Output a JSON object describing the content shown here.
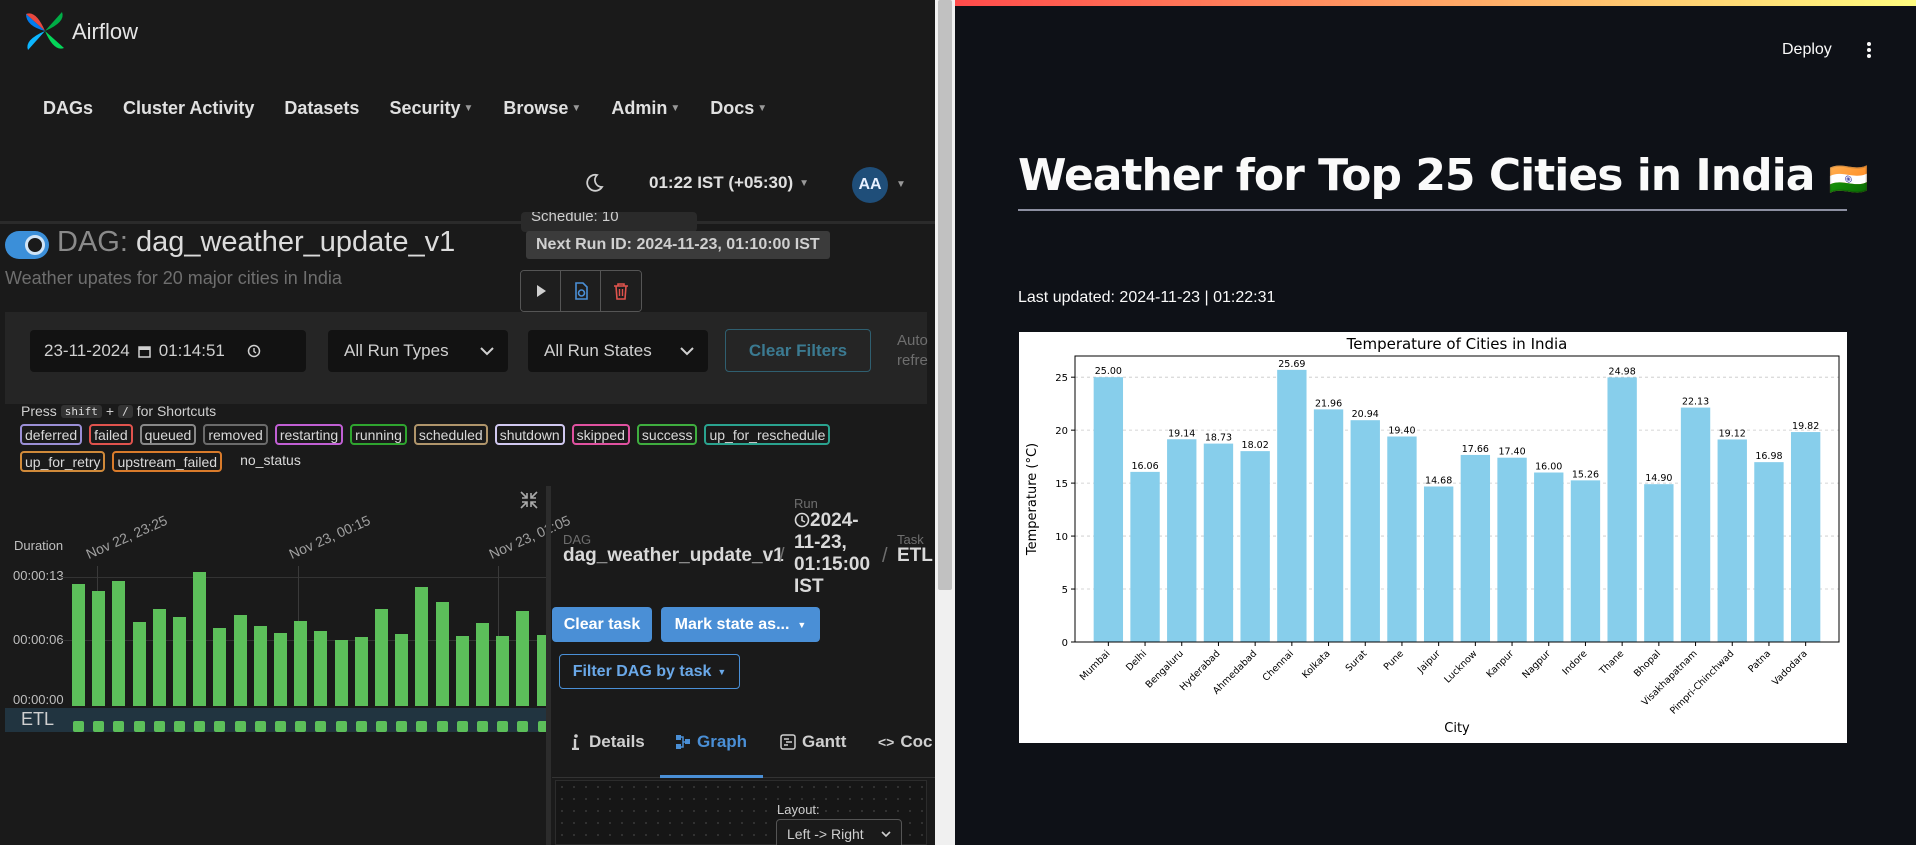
{
  "airflow": {
    "brand": "Airflow",
    "nav": [
      {
        "label": "DAGs",
        "dropdown": false
      },
      {
        "label": "Cluster Activity",
        "dropdown": false
      },
      {
        "label": "Datasets",
        "dropdown": false
      },
      {
        "label": "Security",
        "dropdown": true
      },
      {
        "label": "Browse",
        "dropdown": true
      },
      {
        "label": "Admin",
        "dropdown": true
      },
      {
        "label": "Docs",
        "dropdown": true
      }
    ],
    "timezone": "01:22 IST (+05:30)",
    "avatar": "AA",
    "dag_prefix": "DAG:",
    "dag_id": "dag_weather_update_v1",
    "description": "Weather upates for 20 major cities in India",
    "schedule": "Schedule: 10",
    "next_run": "Next Run ID: 2024-11-23, 01:10:00 IST",
    "filters": {
      "date": "23-11-2024",
      "time": "01:14:51",
      "run_types": "All Run Types",
      "run_states": "All Run States",
      "clear": "Clear Filters",
      "auto_refresh_1": "Auto",
      "auto_refresh_2": "refre"
    },
    "shortcuts": {
      "press": "Press",
      "key1": "shift",
      "plus": "+",
      "key2": "/",
      "suffix": "for Shortcuts"
    },
    "states": [
      {
        "label": "deferred",
        "color": "#9b8fd6"
      },
      {
        "label": "failed",
        "color": "#e0534d"
      },
      {
        "label": "queued",
        "color": "#888888"
      },
      {
        "label": "removed",
        "color": "#6b6b6b"
      },
      {
        "label": "restarting",
        "color": "#c15fd4"
      },
      {
        "label": "running",
        "color": "#2fa52f"
      },
      {
        "label": "scheduled",
        "color": "#b0956b"
      },
      {
        "label": "shutdown",
        "color": "#d0c8f0"
      },
      {
        "label": "skipped",
        "color": "#e052a0"
      },
      {
        "label": "success",
        "color": "#3fae3f"
      },
      {
        "label": "up_for_reschedule",
        "color": "#2aa38f"
      },
      {
        "label": "up_for_retry",
        "color": "#d08a3a"
      },
      {
        "label": "upstream_failed",
        "color": "#d97b2b"
      },
      {
        "label": "no_status",
        "color": ""
      }
    ],
    "grid": {
      "duration_label": "Duration",
      "y_ticks": [
        "00:00:13",
        "00:00:06",
        "00:00:00"
      ],
      "date_labels": [
        "Nov 22, 23:25",
        "Nov 23, 00:15",
        "Nov 23, 01:05"
      ],
      "durations_sec": [
        12.3,
        11.6,
        12.6,
        8.5,
        9.8,
        9.0,
        13.5,
        7.9,
        9.2,
        8.1,
        7.4,
        8.6,
        7.6,
        6.7,
        7.0,
        9.8,
        7.3,
        12.0,
        10.5,
        7.1,
        8.4,
        7.1,
        9.6,
        7.2
      ],
      "task_row": "ETL"
    },
    "details": {
      "dag_label": "DAG",
      "dag": "dag_weather_update_v1",
      "run_label": "Run",
      "run": "2024-11-23, 01:15:00 IST",
      "task_label": "Task",
      "task": "ETL",
      "clear_task": "Clear task",
      "mark_state": "Mark state as...",
      "filter_dag": "Filter DAG by task",
      "tabs": [
        {
          "label": "Details",
          "icon": "info-icon"
        },
        {
          "label": "Graph",
          "icon": "graph-icon"
        },
        {
          "label": "Gantt",
          "icon": "gantt-icon"
        },
        {
          "label": "Coc",
          "icon": "code-icon"
        }
      ],
      "layout_label": "Layout:",
      "layout_value": "Left -> Right"
    }
  },
  "streamlit": {
    "deploy": "Deploy",
    "title": "Weather for Top 25 Cities in India",
    "flag": "🇮🇳",
    "updated": "Last updated: 2024-11-23 | 01:22:31"
  },
  "chart_data": {
    "type": "bar",
    "title": "Temperature of Cities in India",
    "xlabel": "City",
    "ylabel": "Temperature (°C)",
    "ylim": [
      0,
      27
    ],
    "yticks": [
      0,
      5,
      10,
      15,
      20,
      25
    ],
    "grid": "y-dashed",
    "bar_color": "#87ceeb",
    "categories": [
      "Mumbai",
      "Delhi",
      "Bengaluru",
      "Hyderabad",
      "Ahmedabad",
      "Chennai",
      "Kolkata",
      "Surat",
      "Pune",
      "Jaipur",
      "Lucknow",
      "Kanpur",
      "Nagpur",
      "Indore",
      "Thane",
      "Bhopal",
      "Visakhapatnam",
      "Pimpri-Chinchwad",
      "Patna",
      "Vadodara"
    ],
    "values": [
      25.0,
      16.06,
      19.14,
      18.73,
      18.02,
      25.69,
      21.96,
      20.94,
      19.4,
      14.68,
      17.66,
      17.4,
      16.0,
      15.26,
      24.98,
      14.9,
      22.13,
      19.12,
      16.98,
      19.82
    ],
    "data_labels": [
      "25.00",
      "16.06",
      "19.14",
      "18.73",
      "18.02",
      "25.69",
      "21.96",
      "20.94",
      "19.40",
      "14.68",
      "17.66",
      "17.40",
      "16.00",
      "15.26",
      "24.98",
      "14.90",
      "22.13",
      "19.12",
      "16.98",
      "19.82"
    ]
  }
}
